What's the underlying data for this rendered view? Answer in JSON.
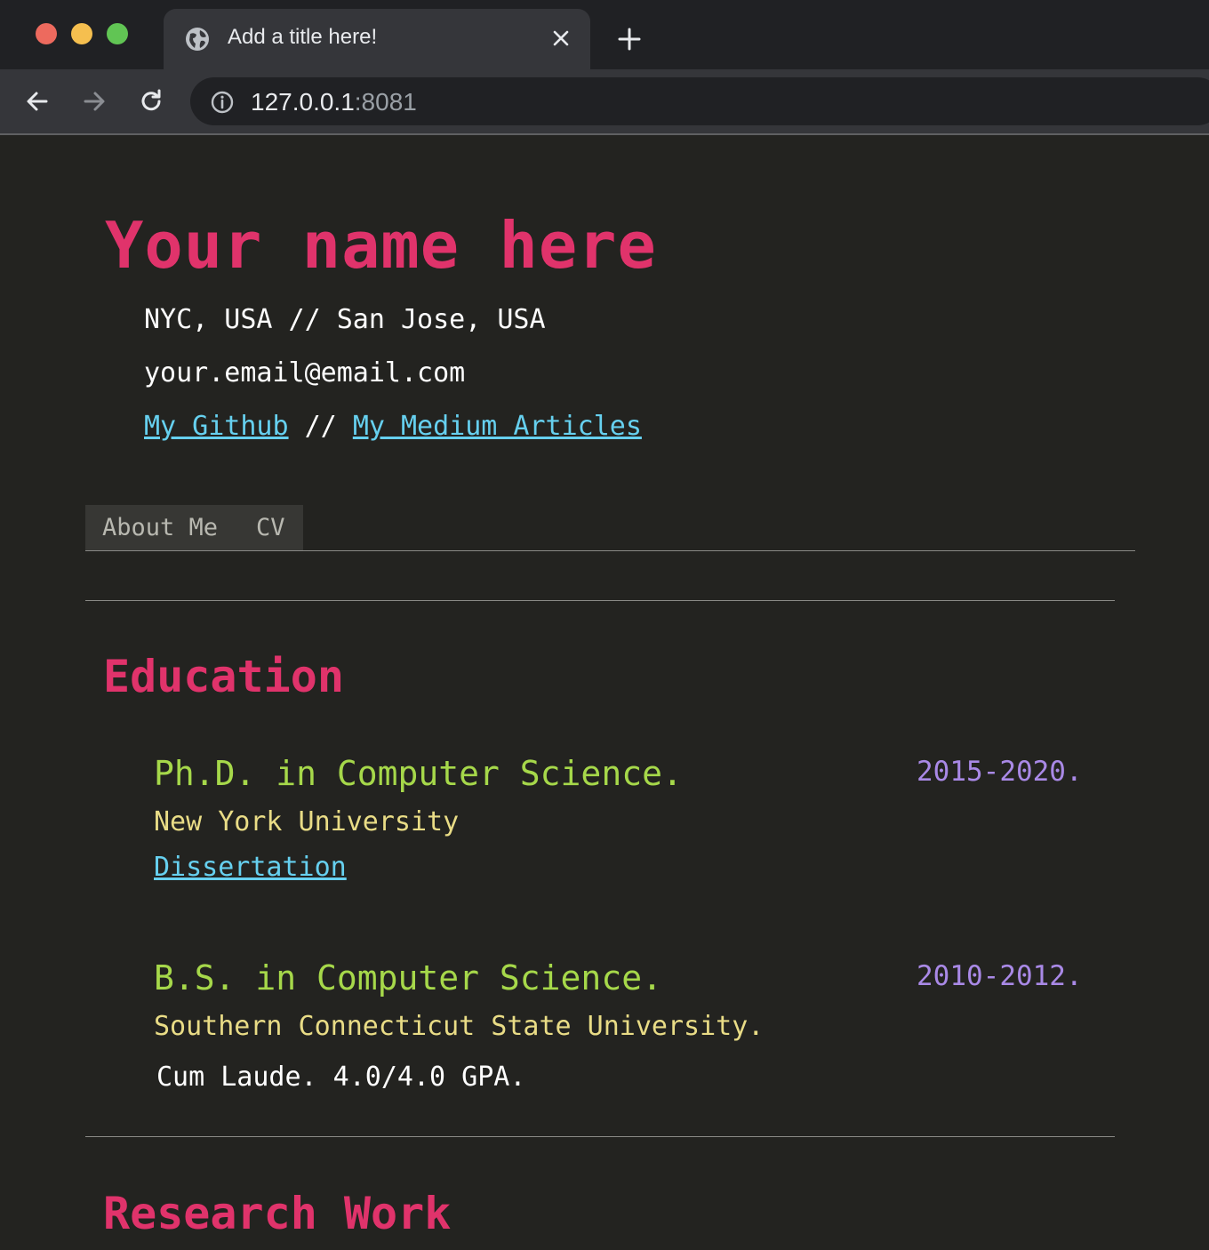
{
  "browser": {
    "tab_title": "Add a title here!",
    "url_host": "127.0.0.1",
    "url_port": ":8081"
  },
  "header": {
    "name": "Your name here",
    "locations": "NYC, USA // San Jose, USA",
    "email": "your.email@email.com",
    "links": {
      "github_label": "My Github",
      "separator": " // ",
      "medium_label": "My Medium Articles"
    }
  },
  "tabs": [
    {
      "label": "About Me"
    },
    {
      "label": "CV"
    }
  ],
  "education": {
    "title": "Education",
    "entries": [
      {
        "degree": "Ph.D. in Computer Science.",
        "years": "2015-2020.",
        "school": "New York University",
        "link_label": "Dissertation"
      },
      {
        "degree": "B.S. in Computer Science.",
        "years": "2010-2012.",
        "school": "Southern Connecticut State University.",
        "note": "Cum Laude. 4.0/4.0 GPA."
      }
    ]
  },
  "research": {
    "title": "Research Work"
  },
  "colors": {
    "accent": "#e0336b",
    "degree": "#a6d84a",
    "school": "#e9dc86",
    "years": "#a989e6",
    "link": "#66d0ef",
    "background": "#232320"
  }
}
